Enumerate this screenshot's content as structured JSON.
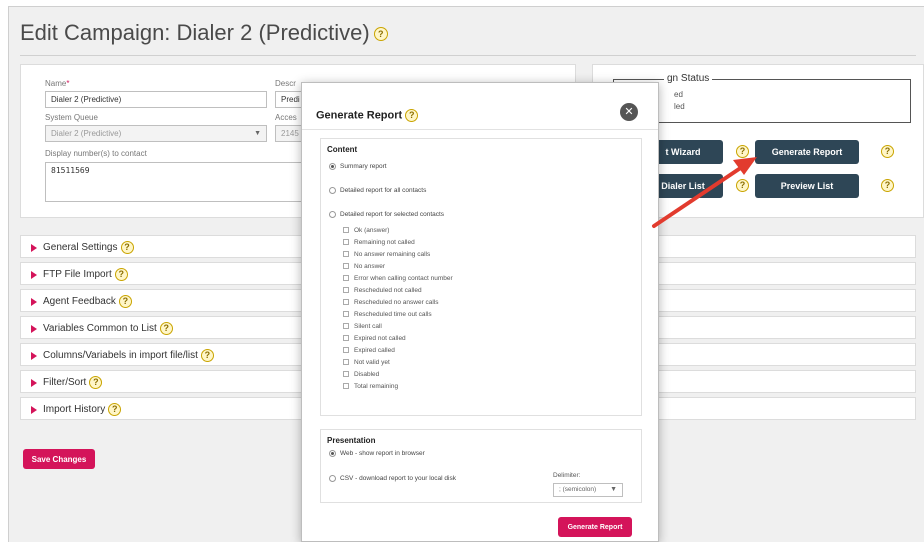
{
  "page": {
    "title": "Edit Campaign: Dialer 2 (Predictive)"
  },
  "form": {
    "name_label": "Name",
    "name_required_mark": "*",
    "name_value": "Dialer 2 (Predictive)",
    "description_label": "Descr",
    "description_value": "Predi",
    "system_queue_label": "System Queue",
    "system_queue_value": "Dialer 2 (Predictive)",
    "access_label": "Acces",
    "access_value": "2145",
    "display_numbers_label": "Display number(s) to contact",
    "display_numbers_value": "81511569"
  },
  "status_panel": {
    "legend": "gn Status",
    "line1": "ed",
    "line2": "led"
  },
  "actions": {
    "import_wizard": "t Wizard",
    "generate_report": "Generate Report",
    "dialer_list": "Dialer List",
    "preview_list": "Preview List"
  },
  "accordion": [
    {
      "label": "General Settings"
    },
    {
      "label": "FTP File Import"
    },
    {
      "label": "Agent Feedback"
    },
    {
      "label": "Variables Common to List"
    },
    {
      "label": "Columns/Variabels in import file/list"
    },
    {
      "label": "Filter/Sort"
    },
    {
      "label": "Import History"
    }
  ],
  "save_button": "Save Changes",
  "modal": {
    "title": "Generate Report",
    "close_glyph": "✕",
    "content_title": "Content",
    "report_types": [
      {
        "label": "Summary report",
        "selected": true
      },
      {
        "label": "Detailed report for all contacts",
        "selected": false
      },
      {
        "label": "Detailed report for selected contacts",
        "selected": false
      }
    ],
    "contact_filters": [
      "Ok (answer)",
      "Remaining not called",
      "No answer remaining calls",
      "No answer",
      "Error when calling contact number",
      "Rescheduled not called",
      "Rescheduled no answer calls",
      "Rescheduled time out calls",
      "Silent call",
      "Expired not called",
      "Expired called",
      "Not valid yet",
      "Disabled",
      "Total remaining"
    ],
    "presentation_title": "Presentation",
    "presentation_options": [
      {
        "label": "Web - show report in browser",
        "selected": true
      },
      {
        "label": "CSV - download report to your local disk",
        "selected": false
      }
    ],
    "delimiter_label": "Delimiter:",
    "delimiter_value": "; (semicolon)",
    "generate_button": "Generate Report"
  },
  "colors": {
    "accent": "#d4145a",
    "dark_button": "#2e4656",
    "arrow": "#e23b2e"
  },
  "icons": {
    "help": "question-mark-help-icon",
    "close": "close-circle-icon",
    "accordion": "triangle-right-icon",
    "dropdown": "chevron-down-icon"
  }
}
